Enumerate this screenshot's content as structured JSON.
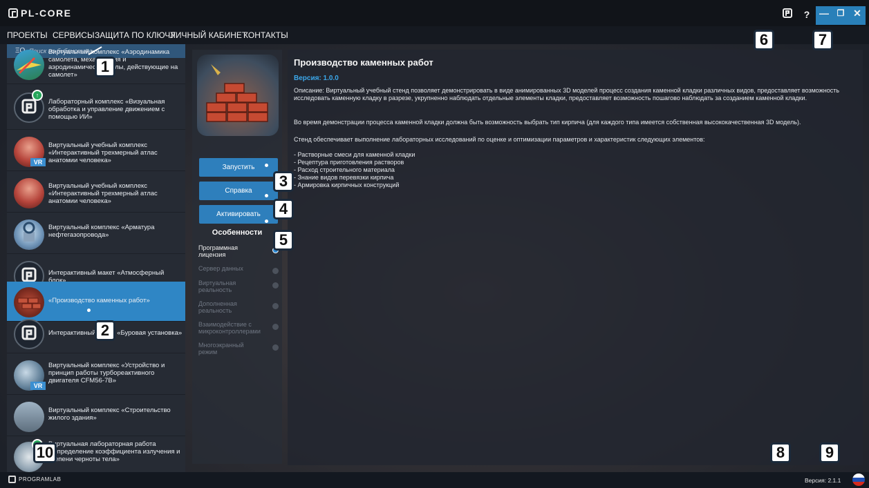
{
  "app": {
    "title": "PL-CORE"
  },
  "menu": [
    "ПРОЕКТЫ",
    "СЕРВИСЫ",
    "ЗАЩИТА ПО КЛЮЧУ",
    "ЛИЧНЫЙ КАБИНЕТ",
    "КОНТАКТЫ"
  ],
  "window_controls": {
    "help": "?",
    "minimize": "—",
    "restore": "❐",
    "close": "✕"
  },
  "search": {
    "icon": "ΞQ",
    "placeholder": "Поиск по библиотеке"
  },
  "library": [
    {
      "label": "Виртуальный комплекс «Аэродинамика самолета, механизация и аэродинамические силы, действующие на самолет»",
      "icon": "plane-thumbnail-icon"
    },
    {
      "label": "Лабораторный комплекс «Визуальная обработка и управление движением с помощью ИИ»",
      "icon": "programlab-logo-icon",
      "badge": "↑"
    },
    {
      "label": "Виртуальный учебный комплекс «Интерактивный трехмерный атлас анатомии человека»",
      "icon": "anatomy-head-icon",
      "badge": "VR"
    },
    {
      "label": "Виртуальный учебный комплекс «Интерактивный трехмерный атлас анатомии человека»",
      "icon": "anatomy-head-icon"
    },
    {
      "label": "Виртуальный комплекс «Арматура нефтегазопровода»",
      "icon": "valve-icon"
    },
    {
      "label": "Интерактивный макет «Атмосферный блок»",
      "icon": "programlab-logo-icon"
    },
    {
      "label": "«Производство каменных работ»",
      "icon": "brick-icon",
      "selected": true
    },
    {
      "label": "Интерактивный макет «Буровая установка»",
      "icon": "programlab-logo-icon"
    },
    {
      "label": "Виртуальный комплекс «Устройство и принцип работы турбореактивного двигателя CFM56-7B»",
      "icon": "engine-icon",
      "badge": "VR"
    },
    {
      "label": "Виртуальный комплекс «Строительство жилого здания»",
      "icon": "building-icon"
    },
    {
      "label": "Виртуальная лабораторная работа «Определение коэффициента излучения и степени черноты тела»",
      "icon": "lab-icon",
      "badge": "↑"
    }
  ],
  "actions": {
    "launch": "Запустить",
    "help": "Справка",
    "activate": "Активировать"
  },
  "features": {
    "title": "Особенности",
    "items": [
      {
        "label": "Программная лицензия",
        "enabled": true
      },
      {
        "label": "Сервер данных",
        "enabled": false
      },
      {
        "label": "Виртуальная реальность",
        "enabled": false
      },
      {
        "label": "Дополненная реальность",
        "enabled": false
      },
      {
        "label": "Взаимодействие с микроконтроллерами",
        "enabled": false
      },
      {
        "label": "Многоэкранный режим",
        "enabled": false
      }
    ]
  },
  "details": {
    "title": "Производство каменных работ",
    "version": "Версия: 1.0.0",
    "description": "Описание: Виртуальный учебный стенд позволяет демонстрировать в виде анимированных 3D моделей процесс создания каменной кладки различных видов, предоставляет возможность исследовать каменную кладку в разрезе, укрупненно наблюдать отдельные элементы кладки, предоставляет возможность пошагово наблюдать за созданием каменной кладки.",
    "paragraph2": "Во время демонстрации процесса каменной кладки должна быть возможность выбрать тип кирпича (для каждого типа имеется собственная высококачественная 3D модель).",
    "paragraph3": "Стенд обеспечивает выполнение лабораторных исследований по оценке и оптимизации параметров и характеристик следующих элементов:",
    "bullets": [
      "- Растворные смеси для каменной кладки",
      "- Рецептура приготовления растворов",
      "- Расход строительного материала",
      "- Знание видов перевязки кирпича",
      "- Армировка кирпичных конструкций"
    ]
  },
  "footer": {
    "brand": "PROGRAMLAB",
    "version": "Версия: 2.1.1"
  },
  "callouts": [
    "1",
    "2",
    "3",
    "4",
    "5",
    "6",
    "7",
    "8",
    "9",
    "10"
  ],
  "colors": {
    "accent": "#2f86c5",
    "version_blue": "#3ba7ea"
  }
}
